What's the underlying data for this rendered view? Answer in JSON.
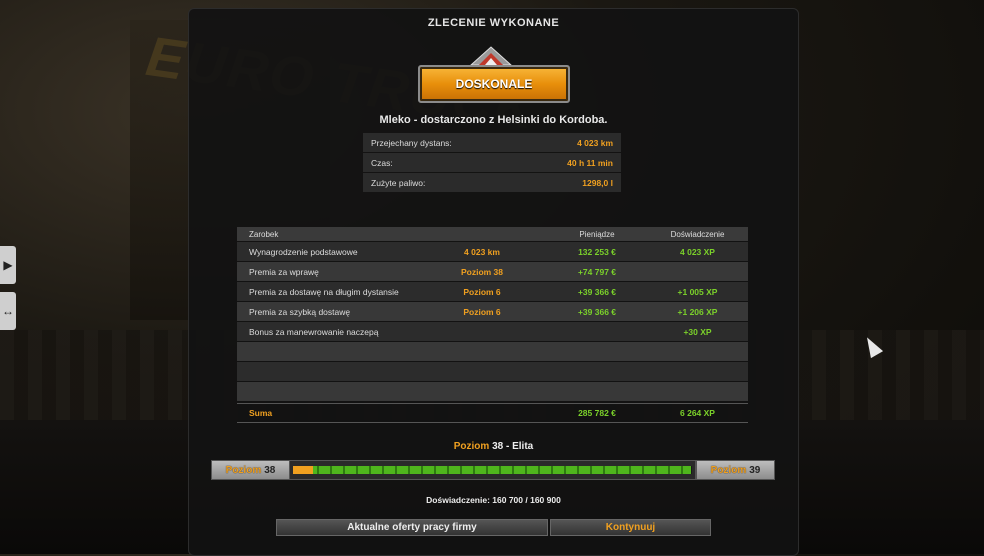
{
  "screen_title": "ZLECENIE WYKONANE",
  "rating": "DOSKONALE",
  "cargo_line": "Mleko - dostarczono z Helsinki do Kordoba.",
  "stats": [
    {
      "label": "Przejechany dystans:",
      "value": "4 023 km"
    },
    {
      "label": "Czas:",
      "value": "40 h 11 min"
    },
    {
      "label": "Zużyte paliwo:",
      "value": "1298,0 l"
    }
  ],
  "earnings": {
    "headers": {
      "name": "Zarobek",
      "detail": "",
      "money": "Pieniądze",
      "xp": "Doświadczenie"
    },
    "rows": [
      {
        "name": "Wynagrodzenie podstawowe",
        "detail": "4 023 km",
        "money": "132 253 €",
        "xp": "4 023 XP"
      },
      {
        "name": "Premia za wprawę",
        "detail": "Poziom 38",
        "money": "+74 797 €",
        "xp": ""
      },
      {
        "name": "Premia za dostawę na długim dystansie",
        "detail": "Poziom 6",
        "money": "+39 366 €",
        "xp": "+1 005 XP"
      },
      {
        "name": "Premia za szybką dostawę",
        "detail": "Poziom 6",
        "money": "+39 366 €",
        "xp": "+1 206 XP"
      },
      {
        "name": "Bonus za manewrowanie naczepą",
        "detail": "",
        "money": "",
        "xp": "+30 XP"
      },
      {
        "name": "",
        "detail": "",
        "money": "",
        "xp": ""
      },
      {
        "name": "",
        "detail": "",
        "money": "",
        "xp": ""
      },
      {
        "name": "",
        "detail": "",
        "money": "",
        "xp": ""
      }
    ],
    "sum": {
      "name": "Suma",
      "money": "285 782 €",
      "xp": "6 264 XP"
    }
  },
  "level": {
    "title_prefix": "Poziom",
    "current": "38",
    "title_suffix": "- Elita",
    "left_label": "Poziom",
    "left_value": "38",
    "right_label": "Poziom",
    "right_value": "39",
    "progress_fraction": 0.9975,
    "new_xp_fraction": 0.05
  },
  "experience_text": "Doświadczenie: 160 700 / 160 900",
  "buttons": {
    "offers": "Aktualne oferty pracy firmy",
    "continue": "Kontynuuj"
  },
  "colors": {
    "accent": "#f0a020",
    "positive": "#7bd12a",
    "progress": "#4fb51d"
  }
}
